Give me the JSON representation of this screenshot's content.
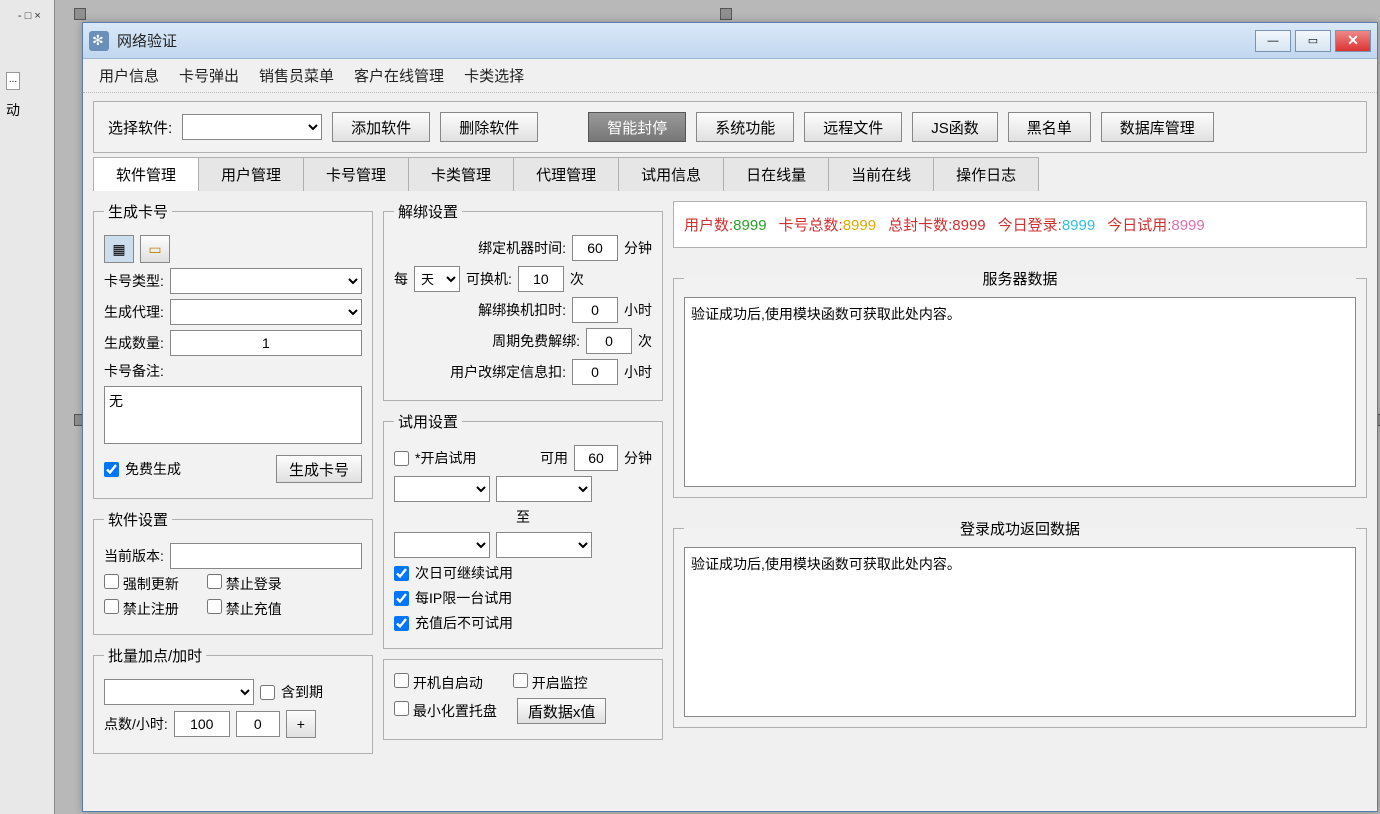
{
  "window_title": "网络验证",
  "side": {
    "ctrl": "- □ ×",
    "dots": "...",
    "lbl": "动"
  },
  "menu": [
    "用户信息",
    "卡号弹出",
    "销售员菜单",
    "客户在线管理",
    "卡类选择"
  ],
  "toolbar": {
    "select_software_lbl": "选择软件:",
    "add_software": "添加软件",
    "del_software": "删除软件",
    "smart_block": "智能封停",
    "sys_func": "系统功能",
    "remote_file": "远程文件",
    "js_func": "JS函数",
    "blacklist": "黑名单",
    "db_manage": "数据库管理"
  },
  "tabs": [
    "软件管理",
    "用户管理",
    "卡号管理",
    "卡类管理",
    "代理管理",
    "试用信息",
    "日在线量",
    "当前在线",
    "操作日志"
  ],
  "gen_card": {
    "legend": "生成卡号",
    "type_lbl": "卡号类型:",
    "agent_lbl": "生成代理:",
    "count_lbl": "生成数量:",
    "count": "1",
    "note_lbl": "卡号备注:",
    "note": "无",
    "free": "免费生成",
    "gen_btn": "生成卡号"
  },
  "soft_set": {
    "legend": "软件设置",
    "ver_lbl": "当前版本:",
    "force": "强制更新",
    "deny_login": "禁止登录",
    "deny_reg": "禁止注册",
    "deny_recharge": "禁止充值"
  },
  "batch": {
    "legend": "批量加点/加时",
    "include": "含到期",
    "pts_lbl": "点数/小时:",
    "v1": "100",
    "v2": "0"
  },
  "unbind": {
    "legend": "解绑设置",
    "bind_time_lbl": "绑定机器时间:",
    "bind_time": "60",
    "bind_time_unit": "分钟",
    "every": "每",
    "period_opt": "天",
    "switch_lbl": "可换机:",
    "switch": "10",
    "switch_unit": "次",
    "unbind_deduct_lbl": "解绑换机扣时:",
    "unbind_deduct": "0",
    "unbind_deduct_unit": "小时",
    "free_unbind_lbl": "周期免费解绑:",
    "free_unbind": "0",
    "free_unbind_unit": "次",
    "user_mod_lbl": "用户改绑定信息扣:",
    "user_mod": "0",
    "user_mod_unit": "小时"
  },
  "trial": {
    "legend": "试用设置",
    "open": "*开启试用",
    "avail": "可用",
    "avail_v": "60",
    "avail_unit": "分钟",
    "to": "至",
    "next_day": "次日可继续试用",
    "per_ip": "每IP限一台试用",
    "after_recharge": "充值后不可试用"
  },
  "misc": {
    "autostart": "开机自启动",
    "monitor": "开启监控",
    "tray": "最小化置托盘",
    "shield": "盾数据x值"
  },
  "stats": {
    "u_lbl": "用户数:",
    "u": "8999",
    "c_lbl": "卡号总数:",
    "c": "8999",
    "b_lbl": "总封卡数:",
    "b": "8999",
    "l_lbl": "今日登录:",
    "l": "8999",
    "t_lbl": "今日试用:",
    "t": "8999"
  },
  "server_data": {
    "legend": "服务器数据",
    "content": "验证成功后,使用模块函数可获取此处内容。"
  },
  "login_data": {
    "legend": "登录成功返回数据",
    "content": "验证成功后,使用模块函数可获取此处内容。"
  }
}
